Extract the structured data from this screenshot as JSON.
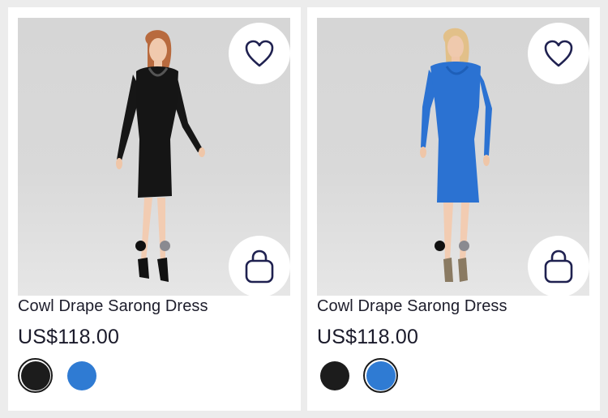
{
  "products": [
    {
      "title": "Cowl Drape Sarong Dress",
      "price": "US$118.00",
      "dress_color": "#151515",
      "image_dots": {
        "count": 2,
        "active_index": 0
      },
      "swatches": [
        {
          "name": "black",
          "color": "#1c1c1c",
          "selected": true
        },
        {
          "name": "blue",
          "color": "#2f7bd3",
          "selected": false
        }
      ]
    },
    {
      "title": "Cowl Drape Sarong Dress",
      "price": "US$118.00",
      "dress_color": "#2b72d2",
      "image_dots": {
        "count": 2,
        "active_index": 0
      },
      "swatches": [
        {
          "name": "black",
          "color": "#1c1c1c",
          "selected": false
        },
        {
          "name": "blue",
          "color": "#2f7bd3",
          "selected": true
        }
      ]
    }
  ],
  "icons": {
    "wishlist": "heart-icon",
    "add_to_bag": "shopping-bag-icon"
  },
  "colors": {
    "icon_navy": "#1f2150",
    "text": "#1d1d2b"
  }
}
